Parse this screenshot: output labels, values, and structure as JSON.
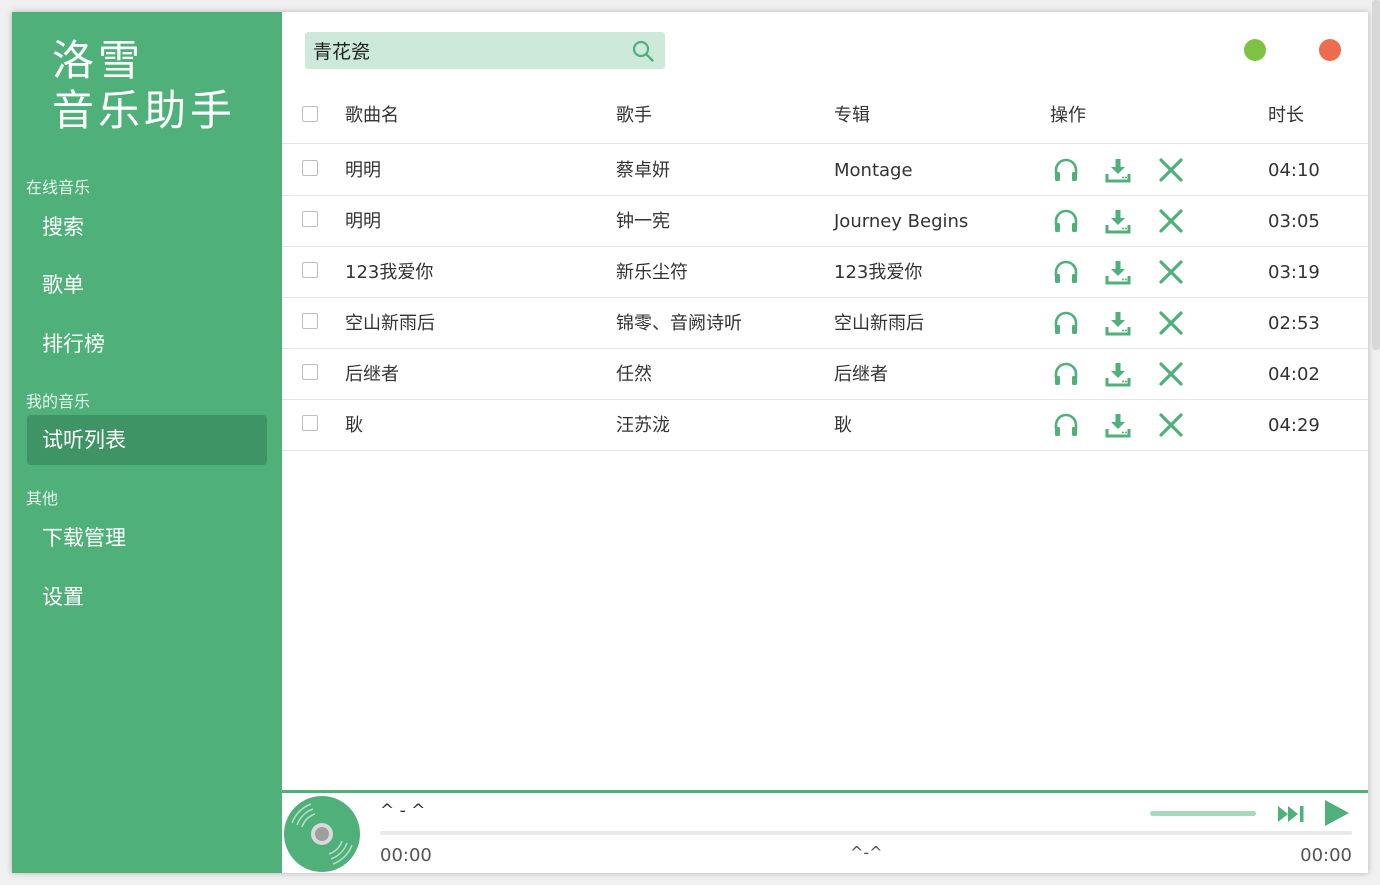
{
  "app": {
    "logo_line1": "洛雪",
    "logo_line2": "音乐助手"
  },
  "sidebar": {
    "sections": [
      {
        "label": "在线音乐",
        "items": [
          {
            "label": "搜索"
          },
          {
            "label": "歌单"
          },
          {
            "label": "排行榜"
          }
        ]
      },
      {
        "label": "我的音乐",
        "items": [
          {
            "label": "试听列表",
            "active": true
          }
        ]
      },
      {
        "label": "其他",
        "items": [
          {
            "label": "下载管理"
          },
          {
            "label": "设置"
          }
        ]
      }
    ]
  },
  "search": {
    "value": "青花瓷",
    "icon": "search-icon"
  },
  "window_controls": {
    "minimize_color": "#7dc243",
    "close_color": "#ee6b4d"
  },
  "table": {
    "headers": {
      "name": "歌曲名",
      "singer": "歌手",
      "album": "专辑",
      "ops": "操作",
      "duration": "时长"
    },
    "rows": [
      {
        "name": "明明",
        "singer": "蔡卓妍",
        "album": "Montage",
        "duration": "04:10"
      },
      {
        "name": "明明",
        "singer": "钟一宪",
        "album": "Journey Begins",
        "duration": "03:05"
      },
      {
        "name": "123我爱你",
        "singer": "新乐尘符",
        "album": "123我爱你",
        "duration": "03:19"
      },
      {
        "name": "空山新雨后",
        "singer": "锦零、音阙诗听",
        "album": "空山新雨后",
        "duration": "02:53"
      },
      {
        "name": "后继者",
        "singer": "任然",
        "album": "后继者",
        "duration": "04:02"
      },
      {
        "name": "耿",
        "singer": "汪苏泷",
        "album": "耿",
        "duration": "04:29"
      }
    ],
    "op_icons": [
      "headphones-icon",
      "download-icon",
      "close-icon"
    ]
  },
  "player": {
    "title": "^ - ^",
    "current_time": "00:00",
    "center_text": "^-^",
    "total_time": "00:00",
    "progress": 0,
    "accent": "#4fb07a"
  }
}
